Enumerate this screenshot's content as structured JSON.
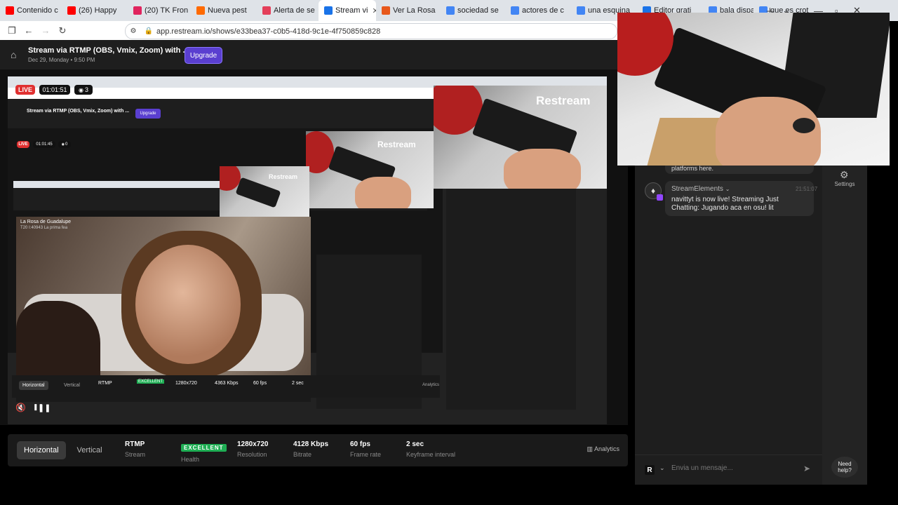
{
  "browser": {
    "tabs": [
      {
        "label": "Contenido c",
        "color": "#ff0000"
      },
      {
        "label": "(26) Happy",
        "color": "#ff0000"
      },
      {
        "label": "(20) TK Fron",
        "color": "#e0245e"
      },
      {
        "label": "Nueva pest",
        "color": "#ff6a00"
      },
      {
        "label": "Alerta de se",
        "color": "#e43f5a"
      },
      {
        "label": "Stream vi",
        "color": "#1a73e8",
        "active": true
      },
      {
        "label": "Ver La Rosa",
        "color": "#e8581b"
      },
      {
        "label": "sociedad se",
        "color": "#4285f4"
      },
      {
        "label": "actores de c",
        "color": "#4285f4"
      },
      {
        "label": "una esquina",
        "color": "#4285f4"
      },
      {
        "label": "Editor grati",
        "color": "#1a73e8"
      },
      {
        "label": "bala dispar",
        "color": "#4285f4"
      },
      {
        "label": "que es crot",
        "color": "#4285f4"
      }
    ],
    "url": "app.restream.io/shows/e33bea37-c0b5-418d-9c1e-4f750859c828"
  },
  "header": {
    "title": "Stream via RTMP (OBS, Vmix, Zoom) with ...",
    "date": "Dec 29, Monday • 9:50 PM",
    "upgrade_label": "Upgrade"
  },
  "preview": {
    "live_label": "LIVE",
    "timer": "01:01:51",
    "viewers": "3",
    "nested_timer": "01:01:45",
    "nested_viewers": "0",
    "brand_label": "Restream",
    "video_title": "La Rosa de Guadalupe",
    "video_subtitle": "T20 I:40943 La prima fea"
  },
  "stats": {
    "orientation": [
      "Horizontal",
      "Vertical"
    ],
    "selected_orientation": "Horizontal",
    "stream_value": "RTMP",
    "stream_label": "Stream",
    "health_value": "EXCELLENT",
    "health_label": "Health",
    "resolution_value": "1280x720",
    "resolution_label": "Resolution",
    "bitrate_value": "4128 Kbps",
    "bitrate_label": "Bitrate",
    "framerate_value": "60 fps",
    "framerate_label": "Frame rate",
    "keyframe_value": "2 sec",
    "keyframe_label": "Keyframe interval",
    "analytics_label": "Analytics"
  },
  "nested_stats": {
    "bitrate_value": "4363 Kbps"
  },
  "chat": {
    "previous_message": "platforms here.",
    "author": "StreamElements",
    "time": "21:51:07",
    "message": "navittyt is now live! Streaming Just Chatting: Jugando aca en osu! lit",
    "input_placeholder": "Envia un mensaje...",
    "r_badge": "R"
  },
  "settings": {
    "label": "Settings"
  },
  "help": {
    "label": "Need help?"
  },
  "colors": {
    "accent": "#5a3fd0",
    "live": "#e03030",
    "health": "#1fae54"
  }
}
